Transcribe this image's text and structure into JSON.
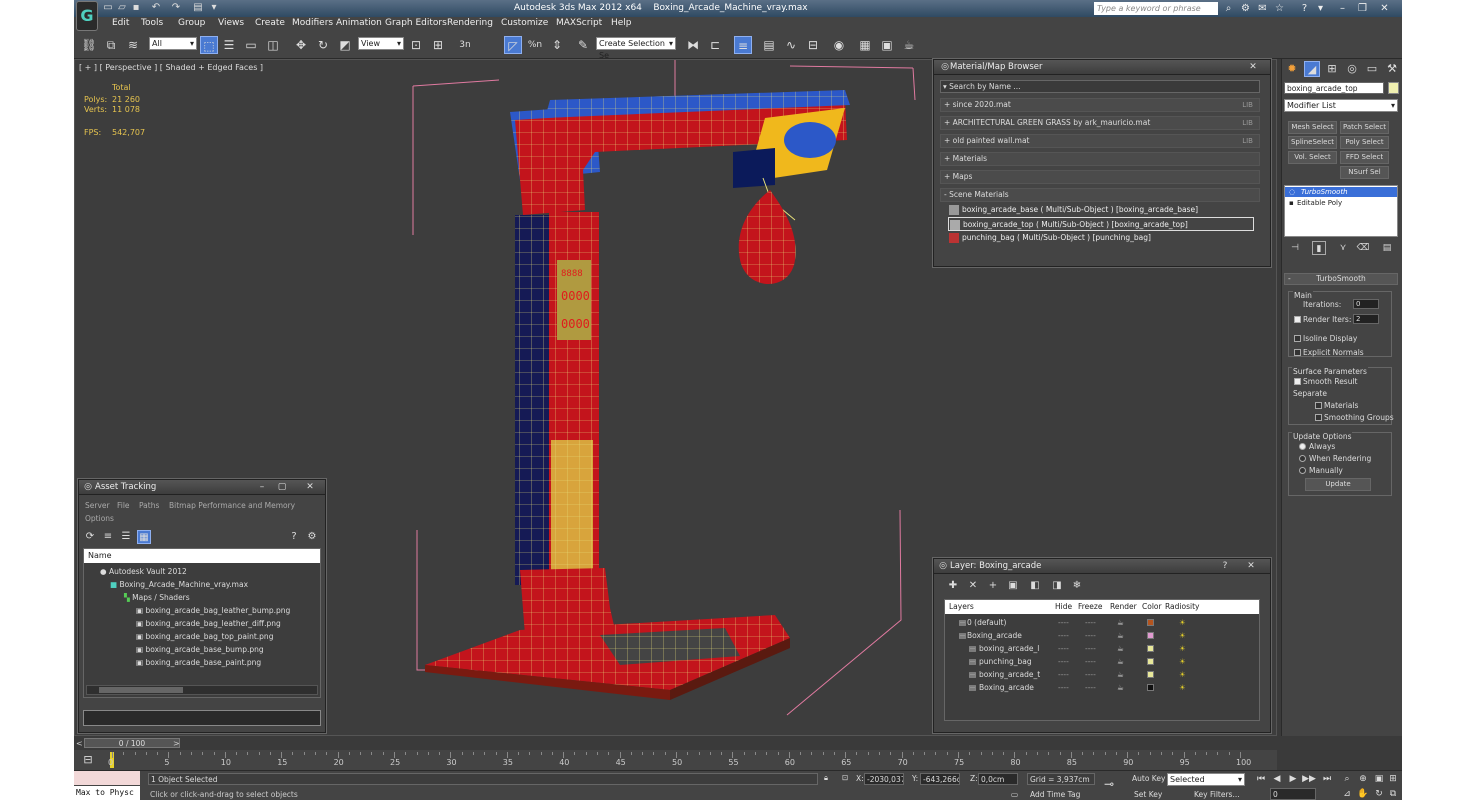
{
  "app": {
    "title": "Autodesk 3ds Max  2012 x64",
    "file": "Boxing_Arcade_Machine_vray.max",
    "search_placeholder": "Type a keyword or phrase",
    "logo_glyph": "G"
  },
  "menu": [
    "Edit",
    "Tools",
    "Group",
    "Views",
    "Create",
    "Modifiers",
    "Animation",
    "Graph Editors",
    "Rendering",
    "Customize",
    "MAXScript",
    "Help"
  ],
  "toolbar": {
    "filter_value": "All",
    "refcoord_value": "View",
    "selection_set_placeholder": "Create Selection Se",
    "snap_labels": [
      "3n",
      "%n"
    ]
  },
  "viewport": {
    "label": "[ + ] [ Perspective ] [ Shaded + Edged Faces ]",
    "stats": {
      "total_label": "Total",
      "polys_label": "Polys:",
      "polys_value": "21 260",
      "verts_label": "Verts:",
      "verts_value": "11 078",
      "fps_label": "FPS:",
      "fps_value": "542,707"
    },
    "screen_text": [
      "8888",
      "0000",
      "0000"
    ]
  },
  "material_browser": {
    "title": "Material/Map Browser",
    "search_placeholder": "Search by Name ...",
    "libraries": [
      {
        "label": "+ since 2020.mat",
        "tag": "LIB"
      },
      {
        "label": "+ ARCHITECTURAL GREEN GRASS by ark_mauricio.mat",
        "tag": "LIB"
      },
      {
        "label": "+ old painted wall.mat",
        "tag": "LIB"
      },
      {
        "label": "+ Materials",
        "tag": ""
      },
      {
        "label": "+ Maps",
        "tag": ""
      },
      {
        "label": "- Scene Materials",
        "tag": ""
      }
    ],
    "scene_materials": [
      "boxing_arcade_base  ( Multi/Sub-Object ) [boxing_arcade_base]",
      "boxing_arcade_top  ( Multi/Sub-Object ) [boxing_arcade_top]",
      "punching_bag  ( Multi/Sub-Object ) [punching_bag]"
    ]
  },
  "asset_tracking": {
    "title": "Asset Tracking",
    "menu": [
      "Server",
      "File",
      "Paths",
      "Bitmap Performance and Memory",
      "Options"
    ],
    "column": "Name",
    "tree": [
      {
        "label": "Autodesk Vault 2012",
        "indent": 1
      },
      {
        "label": "Boxing_Arcade_Machine_vray.max",
        "indent": 2
      },
      {
        "label": "Maps / Shaders",
        "indent": 3
      },
      {
        "label": "boxing_arcade_bag_leather_bump.png",
        "indent": 4
      },
      {
        "label": "boxing_arcade_bag_leather_diff.png",
        "indent": 4
      },
      {
        "label": "boxing_arcade_bag_top_paint.png",
        "indent": 4
      },
      {
        "label": "boxing_arcade_base_bump.png",
        "indent": 4
      },
      {
        "label": "boxing_arcade_base_paint.png",
        "indent": 4
      }
    ]
  },
  "layer_window": {
    "title": "Layer: Boxing_arcade",
    "columns": [
      "Layers",
      "Hide",
      "Freeze",
      "Render",
      "Color",
      "Radiosity"
    ],
    "rows": [
      {
        "name": "0 (default)",
        "indent": 1,
        "color": "#b5541e",
        "dash": "----"
      },
      {
        "name": "Boxing_arcade",
        "indent": 1,
        "color": "#e09ad0",
        "dash": "----"
      },
      {
        "name": "boxing_arcade_l",
        "indent": 2,
        "color": "#e8e89a",
        "dash": "----"
      },
      {
        "name": "punching_bag",
        "indent": 2,
        "color": "#e8e89a",
        "dash": "----"
      },
      {
        "name": "boxing_arcade_t",
        "indent": 2,
        "color": "#e8e89a",
        "dash": "----"
      },
      {
        "name": "Boxing_arcade",
        "indent": 2,
        "color": "#111111",
        "dash": "----"
      }
    ]
  },
  "command_panel": {
    "object_name": "boxing_arcade_top",
    "modifier_list": "Modifier List",
    "modifier_buttons": [
      "Mesh Select",
      "Patch Select",
      "SplineSelect",
      "Poly Select",
      "Vol. Select",
      "FFD Select",
      "NSurf Sel"
    ],
    "stack": [
      "TurboSmooth",
      "Editable Poly"
    ],
    "rollout_title": "TurboSmooth",
    "main_label": "Main",
    "iterations_label": "Iterations:",
    "iterations_value": "0",
    "render_iters_label": "Render Iters:",
    "render_iters_value": "2",
    "isoline_label": "Isoline Display",
    "explicit_label": "Explicit Normals",
    "surface_label": "Surface Parameters",
    "smooth_label": "Smooth Result",
    "separate_label": "Separate",
    "materials_label": "Materials",
    "smoothing_label": "Smoothing Groups",
    "update_options_label": "Update Options",
    "always_label": "Always",
    "when_rendering_label": "When Rendering",
    "manually_label": "Manually",
    "update_button": "Update"
  },
  "timeline": {
    "frame_label": "0 / 100",
    "ticks": [
      "0",
      "5",
      "10",
      "15",
      "20",
      "25",
      "30",
      "35",
      "40",
      "45",
      "50",
      "55",
      "60",
      "65",
      "70",
      "75",
      "80",
      "85",
      "90",
      "95",
      "100"
    ]
  },
  "status": {
    "maxscript": "Max to Physc",
    "selected": "1 Object Selected",
    "prompt": "Click or click-and-drag to select objects",
    "x_label": "X:",
    "x_value": "-2030,037",
    "y_label": "Y:",
    "y_value": "-643,266c",
    "z_label": "Z:",
    "z_value": "0,0cm",
    "grid": "Grid = 3,937cm",
    "add_time_tag": "Add Time Tag",
    "auto_key": "Auto Key",
    "set_key": "Set Key",
    "key_mode_value": "Selected",
    "key_filters": "Key Filters...",
    "current_frame": "0"
  }
}
